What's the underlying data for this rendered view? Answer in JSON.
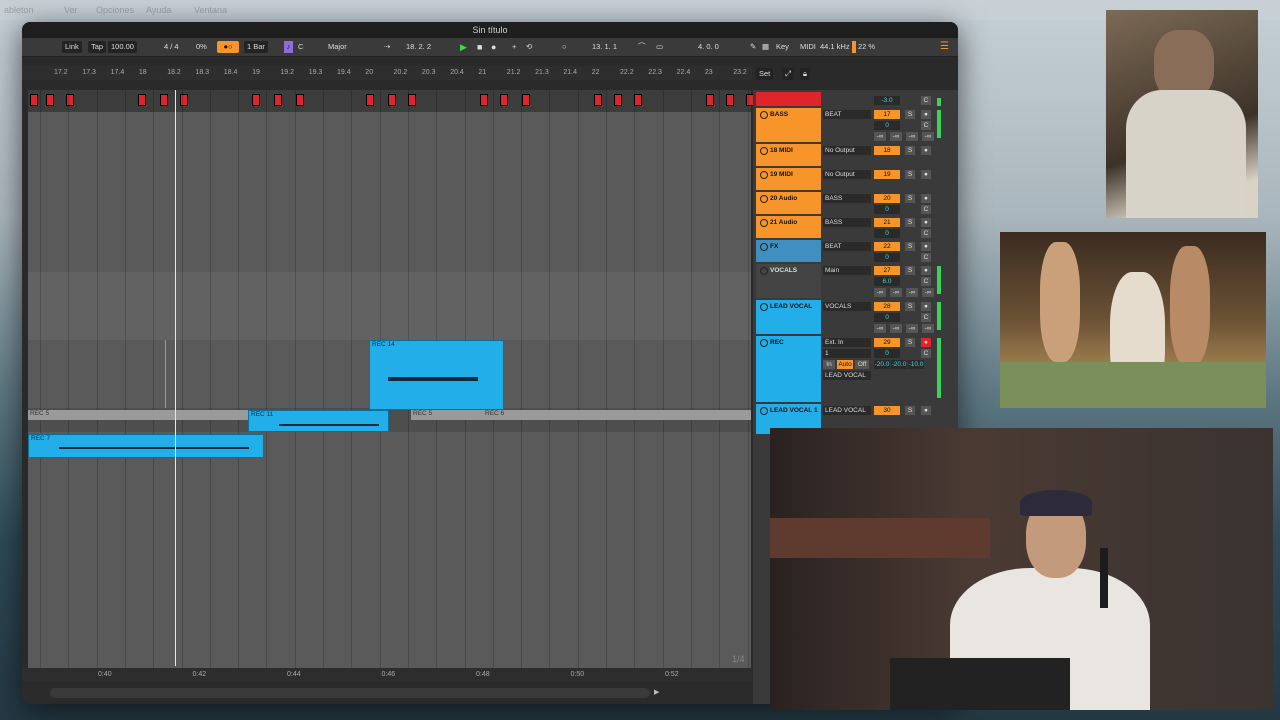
{
  "window": {
    "title": "Sin título"
  },
  "control_bar": {
    "link": "Link",
    "tap": "Tap",
    "tempo": "100.00",
    "signature": "4 / 4",
    "swing": "0%",
    "quantize": "1 Bar",
    "key": "C",
    "scale": "Major",
    "position": "18.  2.  2",
    "loop_start": "13.  1.  1",
    "loop_length": "4.  0.  0",
    "key_btn": "Key",
    "midi_btn": "MIDI",
    "sample_rate": "44.1 kHz",
    "cpu": "22 %"
  },
  "ruler": {
    "bars": [
      "17.2",
      "17.3",
      "17.4",
      "18",
      "18.2",
      "18.3",
      "18.4",
      "19",
      "19.2",
      "19.3",
      "19.4",
      "20",
      "20.2",
      "20.3",
      "20.4",
      "21",
      "21.2",
      "21.3",
      "21.4",
      "22",
      "22.2",
      "22.3",
      "22.4",
      "23",
      "23.2"
    ],
    "set_btn": "Set"
  },
  "clips": {
    "rec14": "REC 14",
    "rec5a": "REC 5",
    "rec11": "REC 11",
    "rec5b": "REC 5",
    "rec6": "REC 6",
    "rec7": "REC 7"
  },
  "timeline": {
    "times": [
      "0:40",
      "0:42",
      "0:44",
      "0:46",
      "0:48",
      "0:50",
      "0:52"
    ],
    "page": "1/4"
  },
  "mixer": {
    "top": {
      "vol": "-3.0",
      "pan": "C"
    },
    "tracks": [
      {
        "name": "BASS",
        "color": "#f7952b",
        "route": "BEAT",
        "num": "17",
        "vol": "0",
        "pan": "C",
        "inf": "-∞"
      },
      {
        "name": "18 MIDI",
        "color": "#f7952b",
        "route": "No Output",
        "num": "18"
      },
      {
        "name": "19 MIDI",
        "color": "#f7952b",
        "route": "No Output",
        "num": "19"
      },
      {
        "name": "20 Audio",
        "color": "#f7952b",
        "route": "BASS",
        "num": "20",
        "vol": "0",
        "pan": "C"
      },
      {
        "name": "21 Audio",
        "color": "#f7952b",
        "route": "BASS",
        "num": "21",
        "vol": "0",
        "pan": "C"
      },
      {
        "name": "FX",
        "color": "#3f8fc0",
        "route": "BEAT",
        "num": "22",
        "vol": "0",
        "pan": "C"
      },
      {
        "name": "VOCALS",
        "color": "#444444",
        "route": "Main",
        "num": "27",
        "vol": "6.0",
        "pan": "C",
        "inf": "-∞"
      },
      {
        "name": "LEAD VOCAL",
        "color": "#22aee8",
        "route": "VOCALS",
        "num": "28",
        "vol": "0",
        "pan": "C",
        "inf": "-∞"
      },
      {
        "name": "REC",
        "color": "#22aee8",
        "route": "Ext. In",
        "num": "29",
        "vol": "0",
        "pan": "C",
        "in": "In",
        "auto": "Auto",
        "off": "Off",
        "send": "-20.0",
        "send2": "-20.0",
        "send3": "-10.0",
        "out": "LEAD VOCAL",
        "ch": "1"
      },
      {
        "name": "LEAD VOCAL 1",
        "color": "#22aee8",
        "route": "LEAD VOCAL",
        "num": "30"
      }
    ],
    "s": "S"
  },
  "desktop_menu": [
    "ableton",
    "Ver",
    "Opciones",
    "Ayuda",
    "Ventana"
  ]
}
